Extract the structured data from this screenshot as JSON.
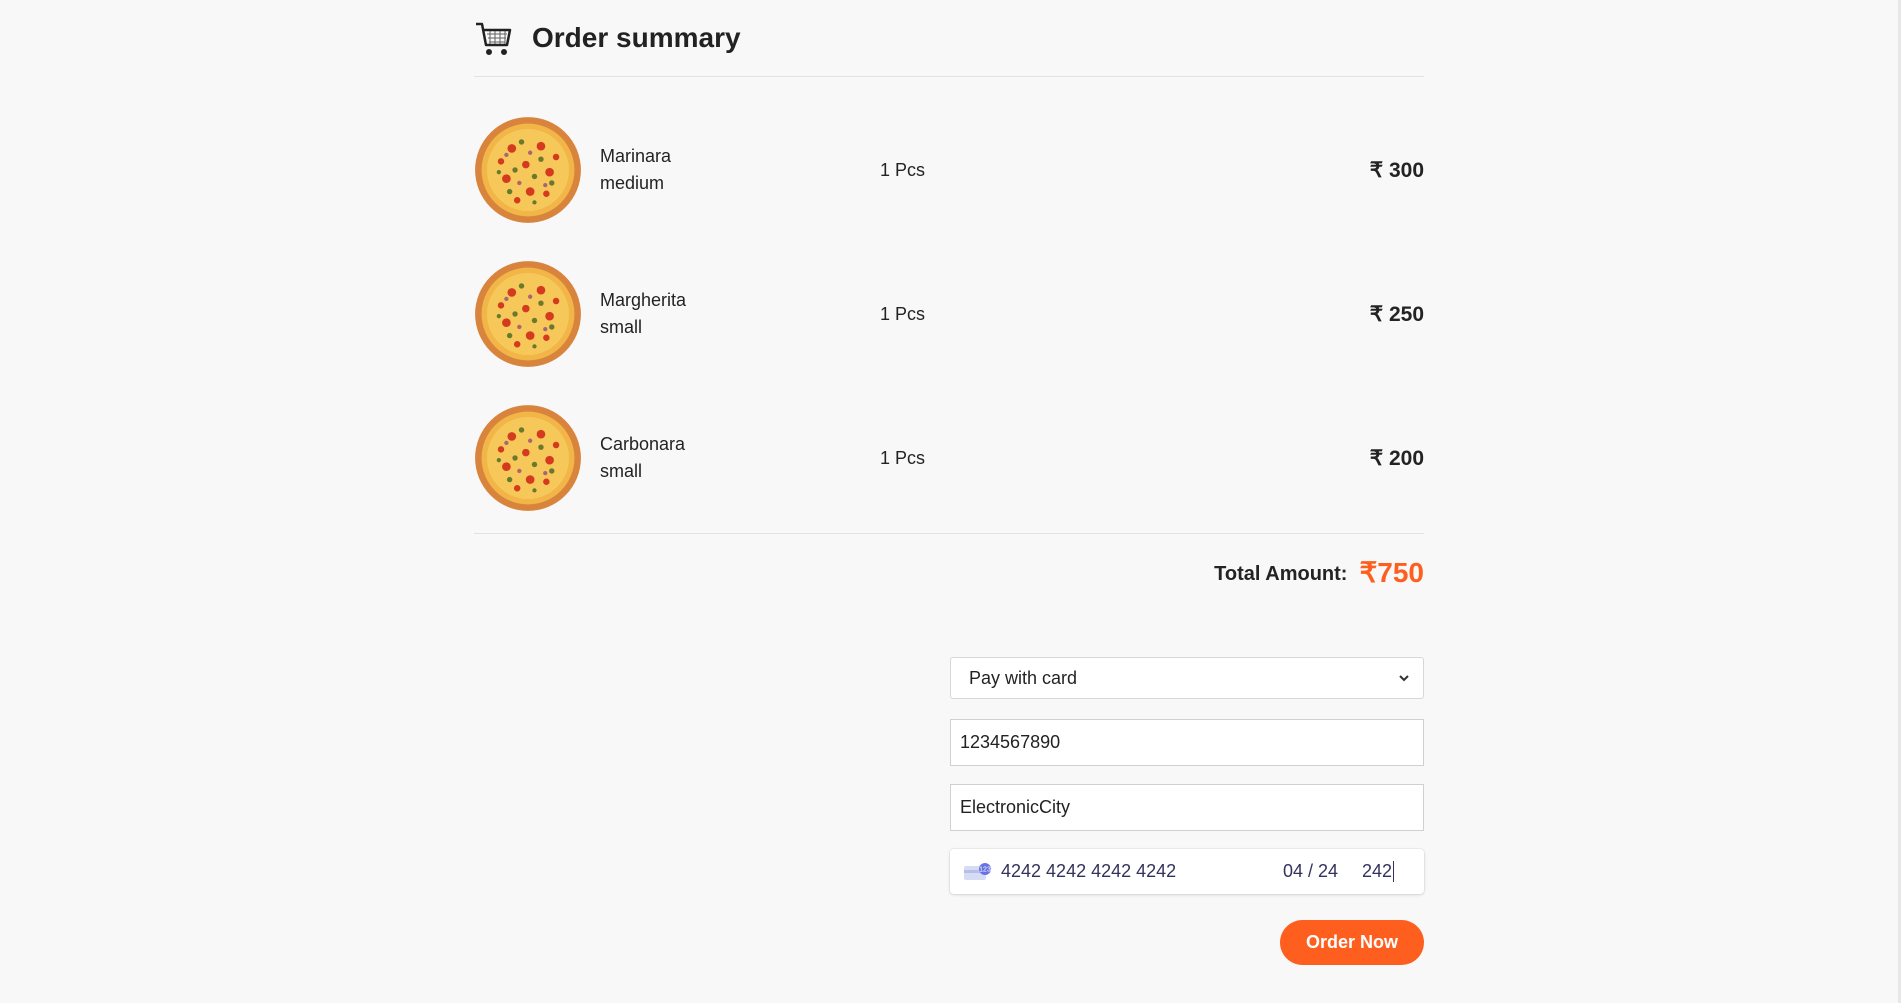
{
  "header": {
    "title": "Order summary",
    "icon": "cart-icon"
  },
  "items": [
    {
      "name": "Marinara",
      "size": "medium",
      "qty": "1 Pcs",
      "price": "₹ 300"
    },
    {
      "name": "Margherita",
      "size": "small",
      "qty": "1 Pcs",
      "price": "₹ 250"
    },
    {
      "name": "Carbonara",
      "size": "small",
      "qty": "1 Pcs",
      "price": "₹ 200"
    }
  ],
  "total": {
    "label": "Total Amount:",
    "value": "₹750"
  },
  "payment": {
    "method": "Pay with card",
    "phone": "1234567890",
    "address": "ElectronicCity",
    "card_number": "4242 4242 4242 4242",
    "expiry": "04 / 24",
    "cvc": "242"
  },
  "order_button": "Order Now",
  "colors": {
    "accent": "#fe5f1e",
    "background": "#f8f8f8",
    "card_text": "#32325d"
  }
}
